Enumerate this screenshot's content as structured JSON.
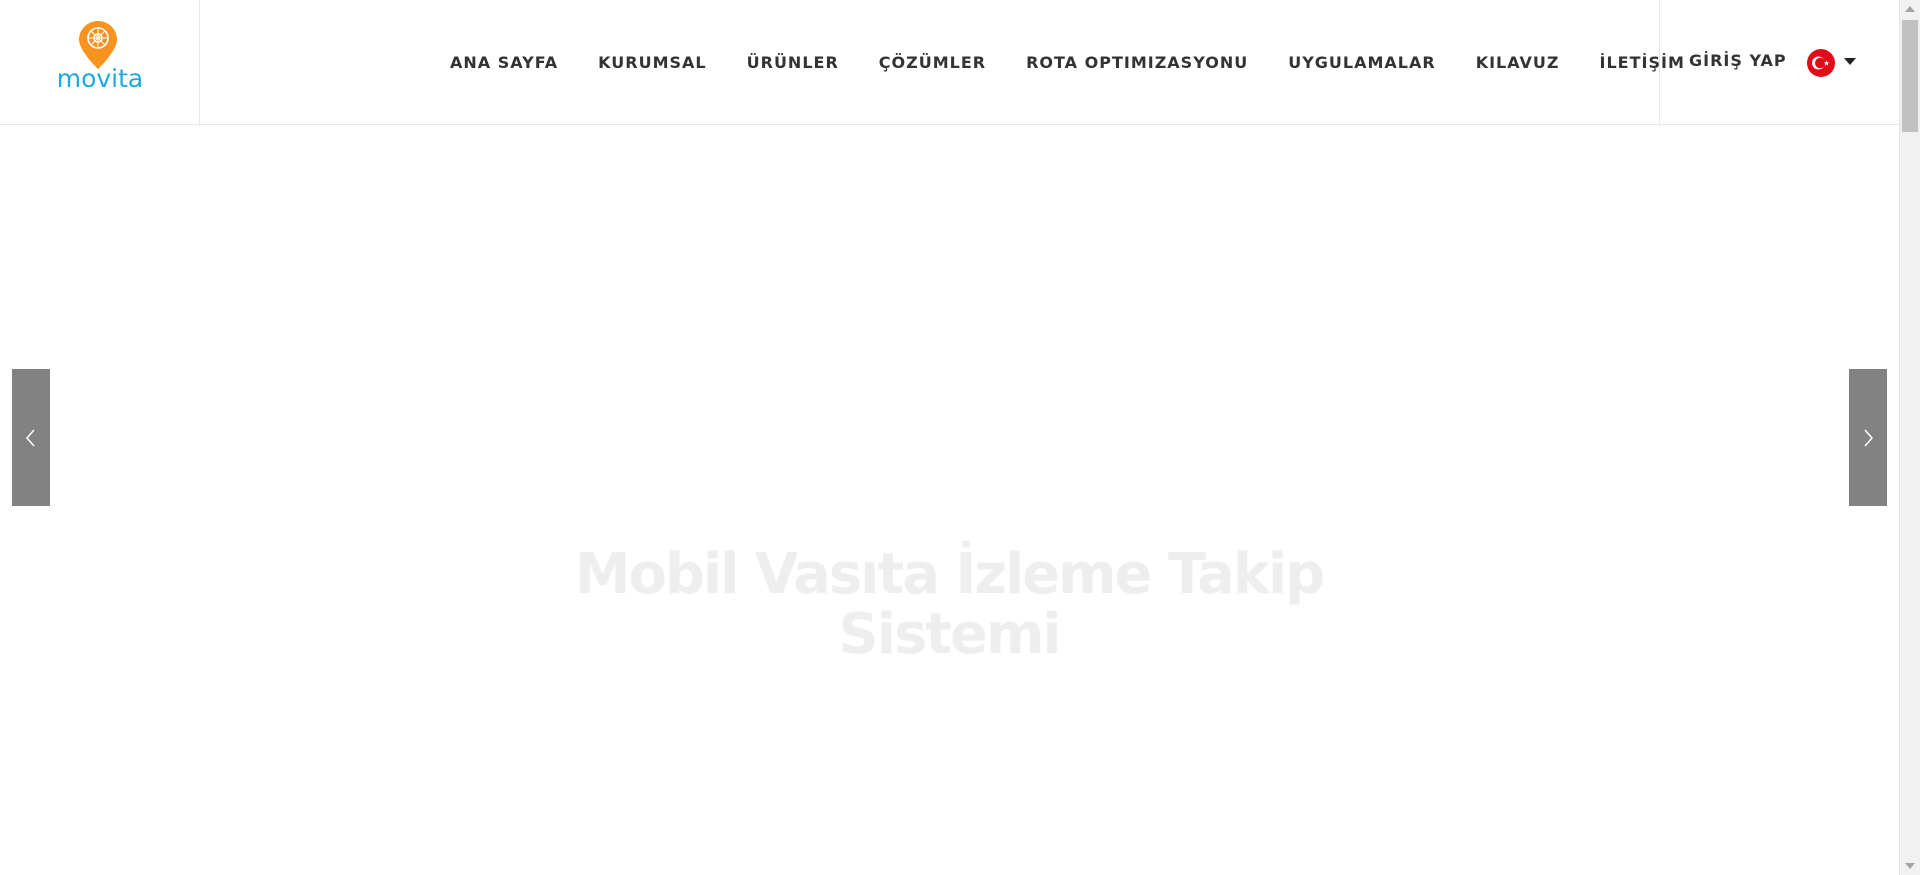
{
  "brand": {
    "logo_text": "movita",
    "logo_color": "#1ea9e1",
    "pin_color": "#f7931e"
  },
  "nav": {
    "items": [
      {
        "label": "ANA SAYFA"
      },
      {
        "label": "KURUMSAL"
      },
      {
        "label": "ÜRÜNLER"
      },
      {
        "label": "ÇÖZÜMLER"
      },
      {
        "label": "ROTA OPTIMIZASYONU"
      },
      {
        "label": "UYGULAMALAR"
      },
      {
        "label": "KILAVUZ"
      },
      {
        "label": "İLETİŞİM"
      }
    ],
    "login_label": "GİRİŞ YAP",
    "language_icon": "turkey-flag-icon",
    "language_dropdown_icon": "caret-down-icon"
  },
  "slider": {
    "headline_line1": "Mobil Vasıta İzleme Takip",
    "headline_line2": "Sistemi",
    "prev_icon": "chevron-left-icon",
    "next_icon": "chevron-right-icon",
    "arrow_color": "#828282"
  },
  "colors": {
    "text": "#333333",
    "flag_red": "#e30a17"
  }
}
